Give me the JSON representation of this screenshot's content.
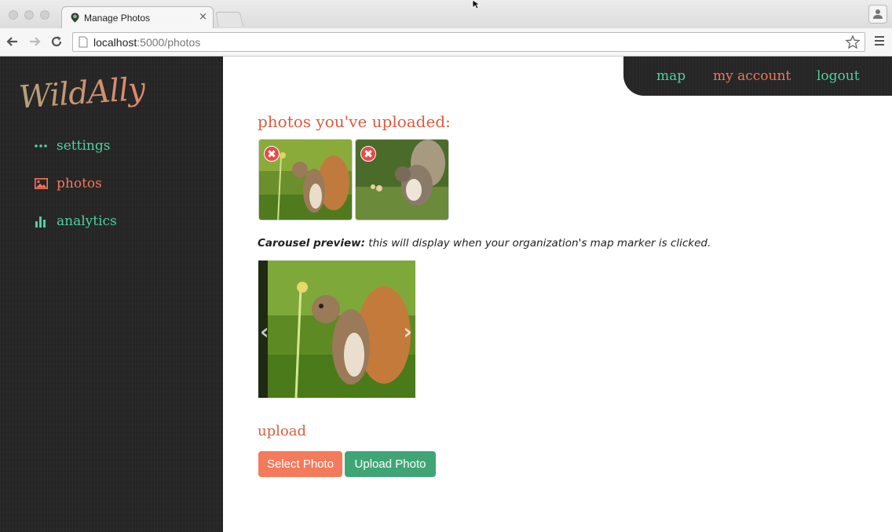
{
  "browser": {
    "tab_title": "Manage Photos",
    "tab_close": "×",
    "url_host": "localhost",
    "url_rest": ":5000/photos"
  },
  "sidebar": {
    "logo": "WildAlly",
    "items": [
      {
        "label": "settings",
        "icon": "dots-icon",
        "color": "#4fd1a0"
      },
      {
        "label": "photos",
        "icon": "image-icon",
        "color": "#f47659"
      },
      {
        "label": "analytics",
        "icon": "bar-chart-icon",
        "color": "#4fd1a0"
      }
    ]
  },
  "topnav": {
    "map": "map",
    "account": "my account",
    "logout": "logout"
  },
  "main": {
    "title": "photos you've uploaded:",
    "photos": [
      {
        "alt": "squirrel-holding-flower",
        "delete": "✖"
      },
      {
        "alt": "squirrel-leaping",
        "delete": "✖"
      }
    ],
    "caption_strong": "Carousel preview:",
    "caption_rest": " this will display when your organization's map marker is clicked.",
    "upload_title": "upload",
    "select_button": "Select Photo",
    "upload_button": "Upload Photo"
  },
  "colors": {
    "accent_red": "#de5a3e",
    "teal": "#4fd1a0",
    "coral": "#f47659",
    "button_green": "#3fa574"
  }
}
